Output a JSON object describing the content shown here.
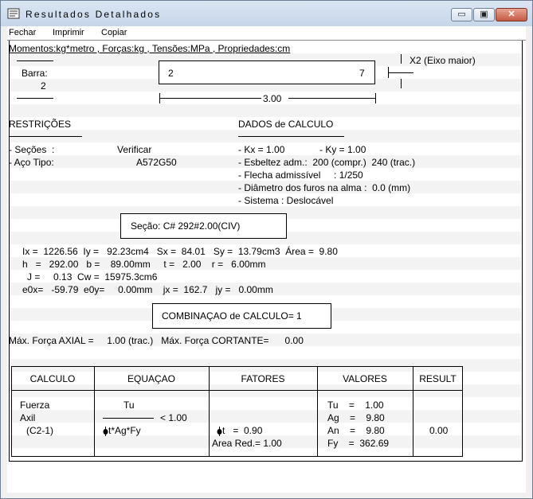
{
  "window": {
    "title": "Resultados Detalhados",
    "controls": {
      "minimize": "▭",
      "maximize": "▣",
      "close": "✕"
    }
  },
  "menu": [
    "Fechar",
    "Imprimir",
    "Copiar"
  ],
  "units_line": "Momentos:kg*metro , Forças:kg , Tensões:MPa , Propriedades:cm",
  "bar": {
    "label": "Barra:",
    "number": "2",
    "node_start": "2",
    "node_end": "7",
    "length": "3.00",
    "axis_label": "X2 (Eixo maior)"
  },
  "restricoes": {
    "heading": "RESTRIÇÕES",
    "secoes_label": "- Seções  :",
    "secoes_value": "Verificar",
    "aco_label": "- Aço Tipo:",
    "aco_value": "A572G50"
  },
  "dados": {
    "heading": "DADOS de CALCULO",
    "kx": "- Kx = 1.00",
    "ky": "- Ky = 1.00",
    "esbeltez": "- Esbeltez adm.:  200 (compr.)  240 (trac.)",
    "flecha": "- Flecha admissível     : 1/250",
    "diametro": "- Diâmetro dos furos na alma :  0.0 (mm)",
    "sistema": "- Sistema : Deslocável"
  },
  "secao": "Seção: C# 292#2.00(CIV)",
  "props": [
    "Ix =  1226.56  Iy =   92.23cm4   Sx =  84.01   Sy =  13.79cm3  Área =  9.80",
    "h   =   292.00   b =    89.00mm     t =   2.00    r =   6.00mm",
    "J =     0.13  Cw =  15975.3cm6",
    "e0x=   -59.79  e0y=     0.00mm    jx =  162.7   jy =   0.00mm"
  ],
  "combinacao": "COMBINAÇAO de CALCULO= 1",
  "max_forces": "Máx. Força AXIAL =     1.00 (trac.)   Máx. Força CORTANTE=      0.00",
  "table": {
    "headers": [
      "CALCULO",
      "EQUAÇAO",
      "FATORES",
      "VALORES",
      "RESULT"
    ],
    "calculo": [
      "Fuerza",
      "Axil",
      "(C2-1)"
    ],
    "eq_num": "Tu",
    "eq_cmp": "< 1.00",
    "eq_den": "t*Ag*Fy",
    "fatores": [
      "t   =  0.90",
      "Area Red.= 1.00"
    ],
    "valores": [
      "Tu    =    1.00",
      "Ag    =    9.80",
      "An    =    9.80",
      "Fy    =  362.69"
    ],
    "result": "0.00"
  }
}
